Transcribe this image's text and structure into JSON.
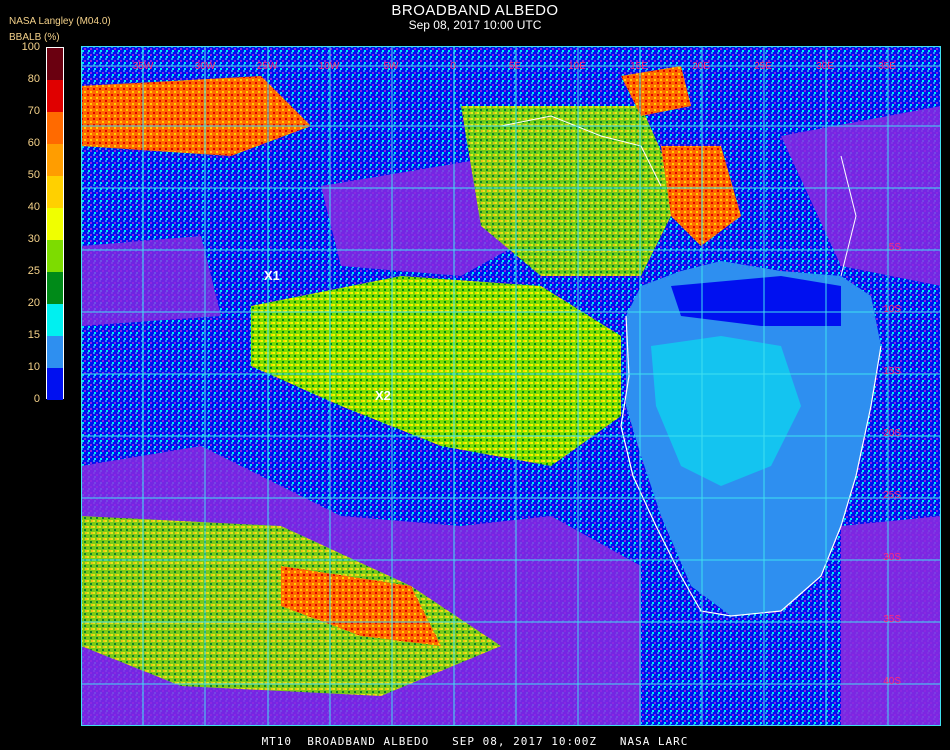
{
  "header": {
    "title": "BROADBAND ALBEDO",
    "subtitle": "Sep 08, 2017 10:00 UTC",
    "org": "NASA Langley (M04.0)",
    "unit": "BBALB (%)"
  },
  "legend": {
    "ticks": [
      "100",
      "80",
      "70",
      "60",
      "50",
      "40",
      "30",
      "25",
      "20",
      "15",
      "10",
      "0"
    ],
    "colors": [
      "#6a0010",
      "#e00000",
      "#ff6a00",
      "#ff9d00",
      "#ffd000",
      "#f0ff00",
      "#7ddc00",
      "#008a18",
      "#00f0f0",
      "#2e8ff0",
      "#0010f0",
      "#8a2ae0"
    ]
  },
  "map": {
    "top_labels": [
      "35W",
      "30W",
      "25W",
      "10W",
      "5W",
      "0",
      "5E",
      "10E",
      "15E",
      "20E",
      "25E",
      "30E",
      "35E"
    ],
    "right_labels": [
      "5S",
      "10S",
      "15S",
      "20S",
      "25S",
      "30S",
      "35S",
      "40S"
    ],
    "markers": [
      {
        "label": "X1"
      },
      {
        "label": "X2"
      }
    ],
    "grid_color": "#3fe0f0",
    "coast_color": "#ffffff"
  },
  "footer": {
    "text": "MT10  BROADBAND ALBEDO   SEP 08, 2017 10:00Z   NASA LARC"
  }
}
